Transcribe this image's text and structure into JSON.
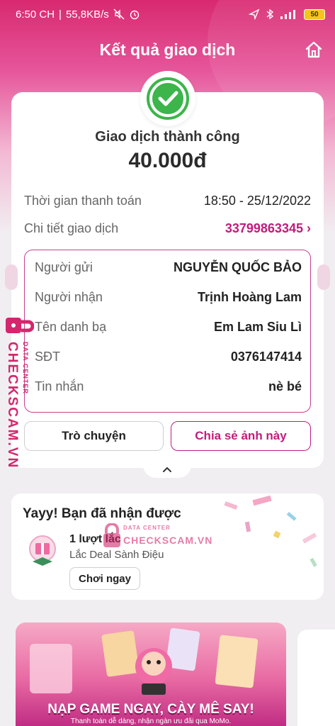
{
  "status_bar": {
    "time": "6:50 CH",
    "network_speed": "55,8KB/s",
    "battery": "50"
  },
  "header": {
    "title": "Kết quả giao dịch"
  },
  "result": {
    "status": "Giao dịch thành công",
    "amount": "40.000đ",
    "payment_time_label": "Thời gian thanh toán",
    "payment_time_value": "18:50 - 25/12/2022",
    "detail_label": "Chi tiết giao dịch",
    "transaction_id": "33799863345"
  },
  "details": {
    "sender_label": "Người gửi",
    "sender_value": "NGUYỄN QUỐC BẢO",
    "receiver_label": "Người nhận",
    "receiver_value": "Trịnh Hoàng Lam",
    "contact_label": "Tên danh bạ",
    "contact_value": "Em Lam Siu Lì",
    "phone_label": "SĐT",
    "phone_value": "0376147414",
    "message_label": "Tin nhắn",
    "message_value": "nè bé"
  },
  "actions": {
    "chat_label": "Trò chuyện",
    "share_label": "Chia sẻ ảnh này"
  },
  "reward": {
    "title": "Yayy! Bạn đã nhận được",
    "turns": "1 lượt lắc",
    "deal": "Lắc Deal Sành Điệu",
    "play_label": "Chơi ngay"
  },
  "watermark": {
    "brand": "CHECKSCAM.VN",
    "tag": "DATA CENTER"
  },
  "banner": {
    "cta": "NẠP GAME NGAY, CÀY MÊ SAY!",
    "sub": "Thanh toán dễ dàng, nhận ngàn ưu đãi qua MoMo."
  },
  "colors": {
    "brand_pink": "#c01d7b",
    "success_green": "#3cb54a"
  }
}
